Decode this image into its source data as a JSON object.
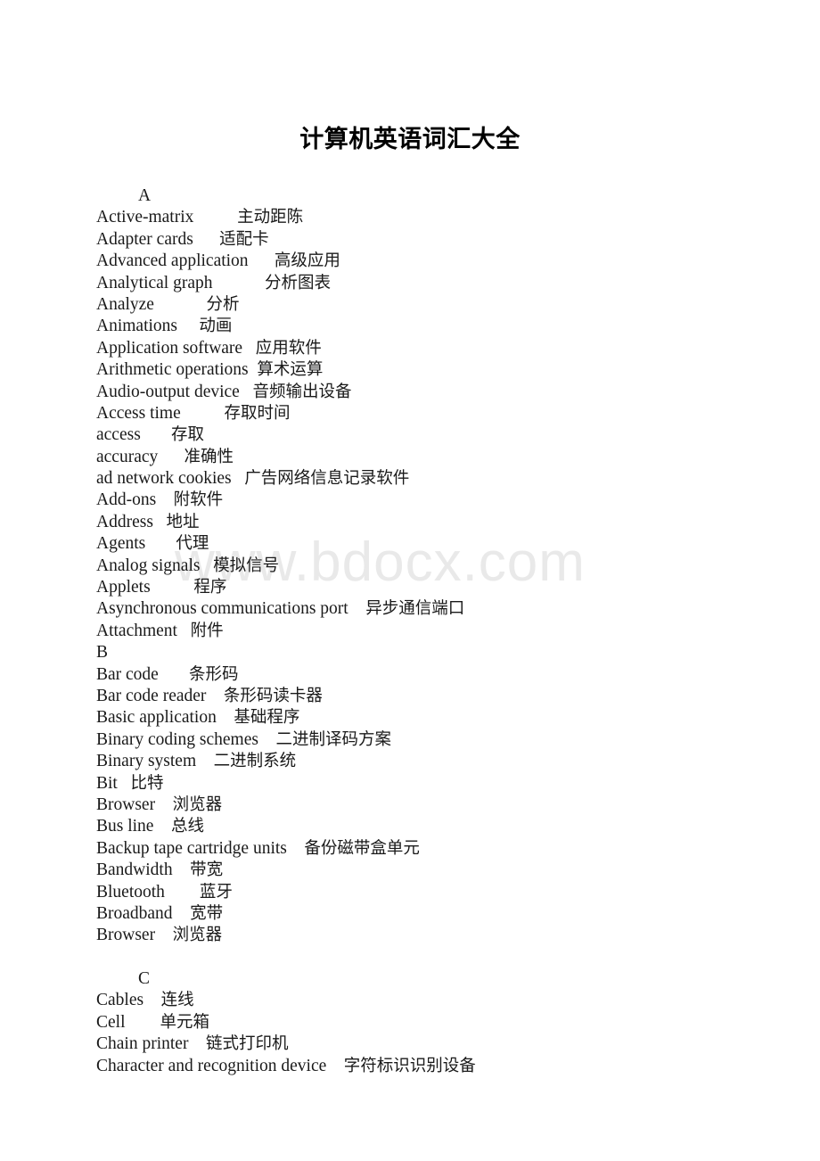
{
  "document": {
    "title": "计算机英语词汇大全",
    "watermark": "www.bdocx.com"
  },
  "entries": [
    {
      "kind": "section",
      "term": "A",
      "indented": true,
      "gap": "",
      "meaning": ""
    },
    {
      "kind": "entry",
      "term": "Active-matrix",
      "gap": "          ",
      "meaning": "主动距陈"
    },
    {
      "kind": "entry",
      "term": "Adapter cards",
      "gap": "      ",
      "meaning": "适配卡"
    },
    {
      "kind": "entry",
      "term": "Advanced application",
      "gap": "      ",
      "meaning": "高级应用"
    },
    {
      "kind": "entry",
      "term": "Analytical graph",
      "gap": "            ",
      "meaning": "分析图表"
    },
    {
      "kind": "entry",
      "term": "Analyze",
      "gap": "            ",
      "meaning": "分析"
    },
    {
      "kind": "entry",
      "term": "Animations",
      "gap": "     ",
      "meaning": "动画"
    },
    {
      "kind": "entry",
      "term": "Application software",
      "gap": "   ",
      "meaning": "应用软件"
    },
    {
      "kind": "entry",
      "term": "Arithmetic operations",
      "gap": "  ",
      "meaning": "算术运算"
    },
    {
      "kind": "entry",
      "term": "Audio-output device",
      "gap": "   ",
      "meaning": "音频输出设备"
    },
    {
      "kind": "entry",
      "term": "Access time",
      "gap": "          ",
      "meaning": "存取时间"
    },
    {
      "kind": "entry",
      "term": "access",
      "gap": "       ",
      "meaning": "存取"
    },
    {
      "kind": "entry",
      "term": "accuracy",
      "gap": "      ",
      "meaning": "准确性"
    },
    {
      "kind": "entry",
      "term": "ad network cookies",
      "gap": "   ",
      "meaning": "广告网络信息记录软件"
    },
    {
      "kind": "entry",
      "term": "Add-ons",
      "gap": "    ",
      "meaning": "附软件"
    },
    {
      "kind": "entry",
      "term": "Address",
      "gap": "   ",
      "meaning": "地址"
    },
    {
      "kind": "entry",
      "term": "Agents",
      "gap": "       ",
      "meaning": "代理"
    },
    {
      "kind": "entry",
      "term": "Analog signals",
      "gap": "   ",
      "meaning": "模拟信号"
    },
    {
      "kind": "entry",
      "term": "Applets",
      "gap": "          ",
      "meaning": "程序"
    },
    {
      "kind": "entry",
      "term": "Asynchronous communications port",
      "gap": "    ",
      "meaning": "异步通信端口"
    },
    {
      "kind": "entry",
      "term": "Attachment",
      "gap": "   ",
      "meaning": "附件"
    },
    {
      "kind": "section",
      "term": "B",
      "indented": false,
      "gap": "",
      "meaning": ""
    },
    {
      "kind": "entry",
      "term": "Bar code",
      "gap": "       ",
      "meaning": "条形码"
    },
    {
      "kind": "entry",
      "term": "Bar code reader",
      "gap": "    ",
      "meaning": "条形码读卡器"
    },
    {
      "kind": "entry",
      "term": "Basic application",
      "gap": "    ",
      "meaning": "基础程序"
    },
    {
      "kind": "entry",
      "term": "Binary coding schemes",
      "gap": "    ",
      "meaning": "二进制译码方案"
    },
    {
      "kind": "entry",
      "term": "Binary system",
      "gap": "    ",
      "meaning": "二进制系统"
    },
    {
      "kind": "entry",
      "term": "Bit",
      "gap": "   ",
      "meaning": "比特"
    },
    {
      "kind": "entry",
      "term": "Browser",
      "gap": "    ",
      "meaning": "浏览器"
    },
    {
      "kind": "entry",
      "term": "Bus line",
      "gap": "    ",
      "meaning": "总线"
    },
    {
      "kind": "entry",
      "term": "Backup tape cartridge units",
      "gap": "    ",
      "meaning": "备份磁带盒单元"
    },
    {
      "kind": "entry",
      "term": "Bandwidth",
      "gap": "    ",
      "meaning": "带宽"
    },
    {
      "kind": "entry",
      "term": "Bluetooth",
      "gap": "        ",
      "meaning": "蓝牙"
    },
    {
      "kind": "entry",
      "term": "Broadband",
      "gap": "    ",
      "meaning": "宽带"
    },
    {
      "kind": "entry",
      "term": "Browser",
      "gap": "    ",
      "meaning": "浏览器"
    },
    {
      "kind": "spacer",
      "term": "",
      "gap": "",
      "meaning": ""
    },
    {
      "kind": "section",
      "term": "C",
      "indented": true,
      "gap": "",
      "meaning": ""
    },
    {
      "kind": "entry",
      "term": "Cables",
      "gap": "    ",
      "meaning": "连线"
    },
    {
      "kind": "entry",
      "term": "Cell",
      "gap": "        ",
      "meaning": "单元箱"
    },
    {
      "kind": "entry",
      "term": "Chain printer",
      "gap": "    ",
      "meaning": "链式打印机"
    },
    {
      "kind": "entry",
      "term": "Character and recognition device",
      "gap": "    ",
      "meaning": "字符标识识别设备"
    }
  ]
}
